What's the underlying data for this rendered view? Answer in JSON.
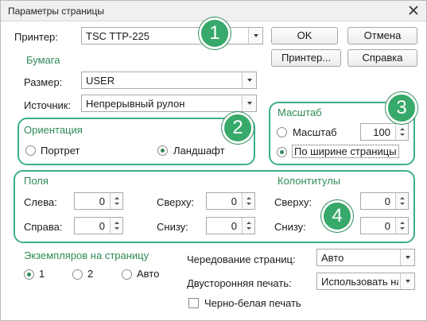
{
  "window": {
    "title": "Параметры страницы",
    "close_icon": "close-icon"
  },
  "printer": {
    "label": "Принтер:",
    "value": "TSC TTP-225"
  },
  "buttons": {
    "ok": "OK",
    "cancel": "Отмена",
    "printer": "Принтер...",
    "help": "Справка"
  },
  "paper": {
    "heading": "Бумага",
    "size_label": "Размер:",
    "size_value": "USER",
    "source_label": "Источник:",
    "source_value": "Непрерывный рулон"
  },
  "orientation": {
    "heading": "Ориентация",
    "portrait": "Портрет",
    "landscape": "Ландшафт",
    "selected": "landscape"
  },
  "scale": {
    "heading": "Масштаб",
    "scale_label": "Масштаб",
    "scale_value": "100",
    "fit_width": "По ширине страницы",
    "selected": "fit_width"
  },
  "margins": {
    "heading": "Поля",
    "left_label": "Слева:",
    "left_value": "0",
    "right_label": "Справа:",
    "right_value": "0",
    "top_label": "Сверху:",
    "top_value": "0",
    "bottom_label": "Снизу:",
    "bottom_value": "0"
  },
  "headers": {
    "heading": "Колонтитулы",
    "top_label": "Сверху:",
    "top_value": "0",
    "bottom_label": "Снизу:",
    "bottom_value": "0"
  },
  "copies": {
    "heading": "Экземпляров на страницу",
    "opt1": "1",
    "opt2": "2",
    "opt_auto": "Авто",
    "selected": "1"
  },
  "alternation": {
    "label": "Чередование страниц:",
    "value": "Авто"
  },
  "duplex": {
    "label": "Двусторонняя печать:",
    "value": "Использовать на"
  },
  "bw": {
    "label": "Черно-белая печать",
    "checked": false
  },
  "markers": [
    "1",
    "2",
    "3",
    "4"
  ],
  "colors": {
    "accent": "#2e8b57",
    "highlight_box": "#3cb08a",
    "marker": "#37a96a"
  }
}
